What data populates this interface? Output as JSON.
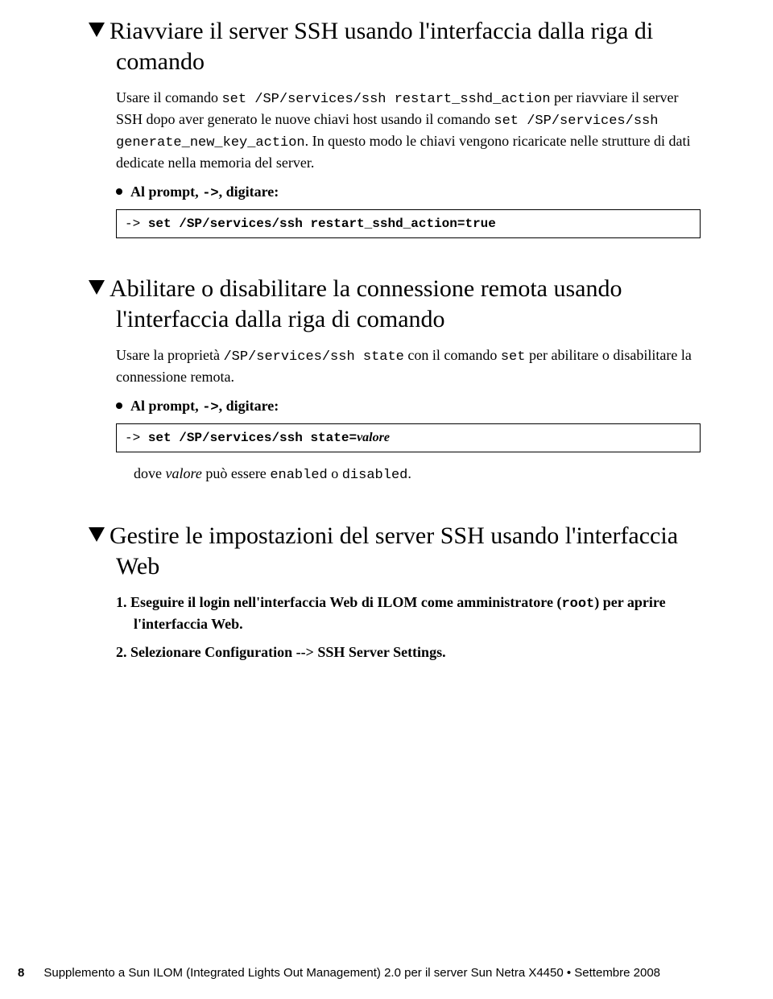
{
  "section1": {
    "heading": "Riavviare il server SSH usando l'interfaccia dalla riga di comando",
    "para_parts": {
      "p1": "Usare il comando ",
      "c1": "set /SP/services/ssh restart_sshd_action",
      "p2": " per riavviare il server SSH dopo aver generato le nuove chiavi host usando il comando ",
      "c2": "set /SP/services/ssh generate_new_key_action",
      "p3": ". In questo modo le chiavi vengono ricaricate nelle strutture di dati dedicate nella memoria del server."
    },
    "bullet_parts": {
      "b1": "Al prompt, ",
      "c1": "->",
      "b2": ", digitare:"
    },
    "code": {
      "prefix": "-> ",
      "cmd": "set /SP/services/ssh restart_sshd_action=true"
    }
  },
  "section2": {
    "heading": "Abilitare o disabilitare la connessione remota usando l'interfaccia dalla riga di comando",
    "para_parts": {
      "p1": "Usare la proprietà ",
      "c1": "/SP/services/ssh state",
      "p2": " con il comando ",
      "c2": "set",
      "p3": " per abilitare o disabilitare la connessione remota."
    },
    "bullet_parts": {
      "b1": "Al prompt, ",
      "c1": "->",
      "b2": ", digitare:"
    },
    "code": {
      "prefix": "-> ",
      "cmd": "set /SP/services/ssh state=",
      "var": "valore"
    },
    "after_parts": {
      "d1": "dove ",
      "v1": "valore",
      "d2": " può essere ",
      "c1": "enabled",
      "d3": " o ",
      "c2": "disabled",
      "d4": "."
    }
  },
  "section3": {
    "heading": "Gestire le impostazioni del server SSH usando l'interfaccia Web",
    "step1": {
      "n": "1. ",
      "t1": "Eseguire il login nell'interfaccia Web di ILOM come amministratore (",
      "c1": "root",
      "t2": ") per aprire l'interfaccia Web."
    },
    "step2": {
      "n": "2. ",
      "t1": "Selezionare Configuration --> SSH Server Settings."
    }
  },
  "footer": {
    "page": "8",
    "title": "Supplemento a Sun ILOM (Integrated Lights Out Management) 2.0 per il server Sun Netra X4450 • Settembre 2008"
  }
}
